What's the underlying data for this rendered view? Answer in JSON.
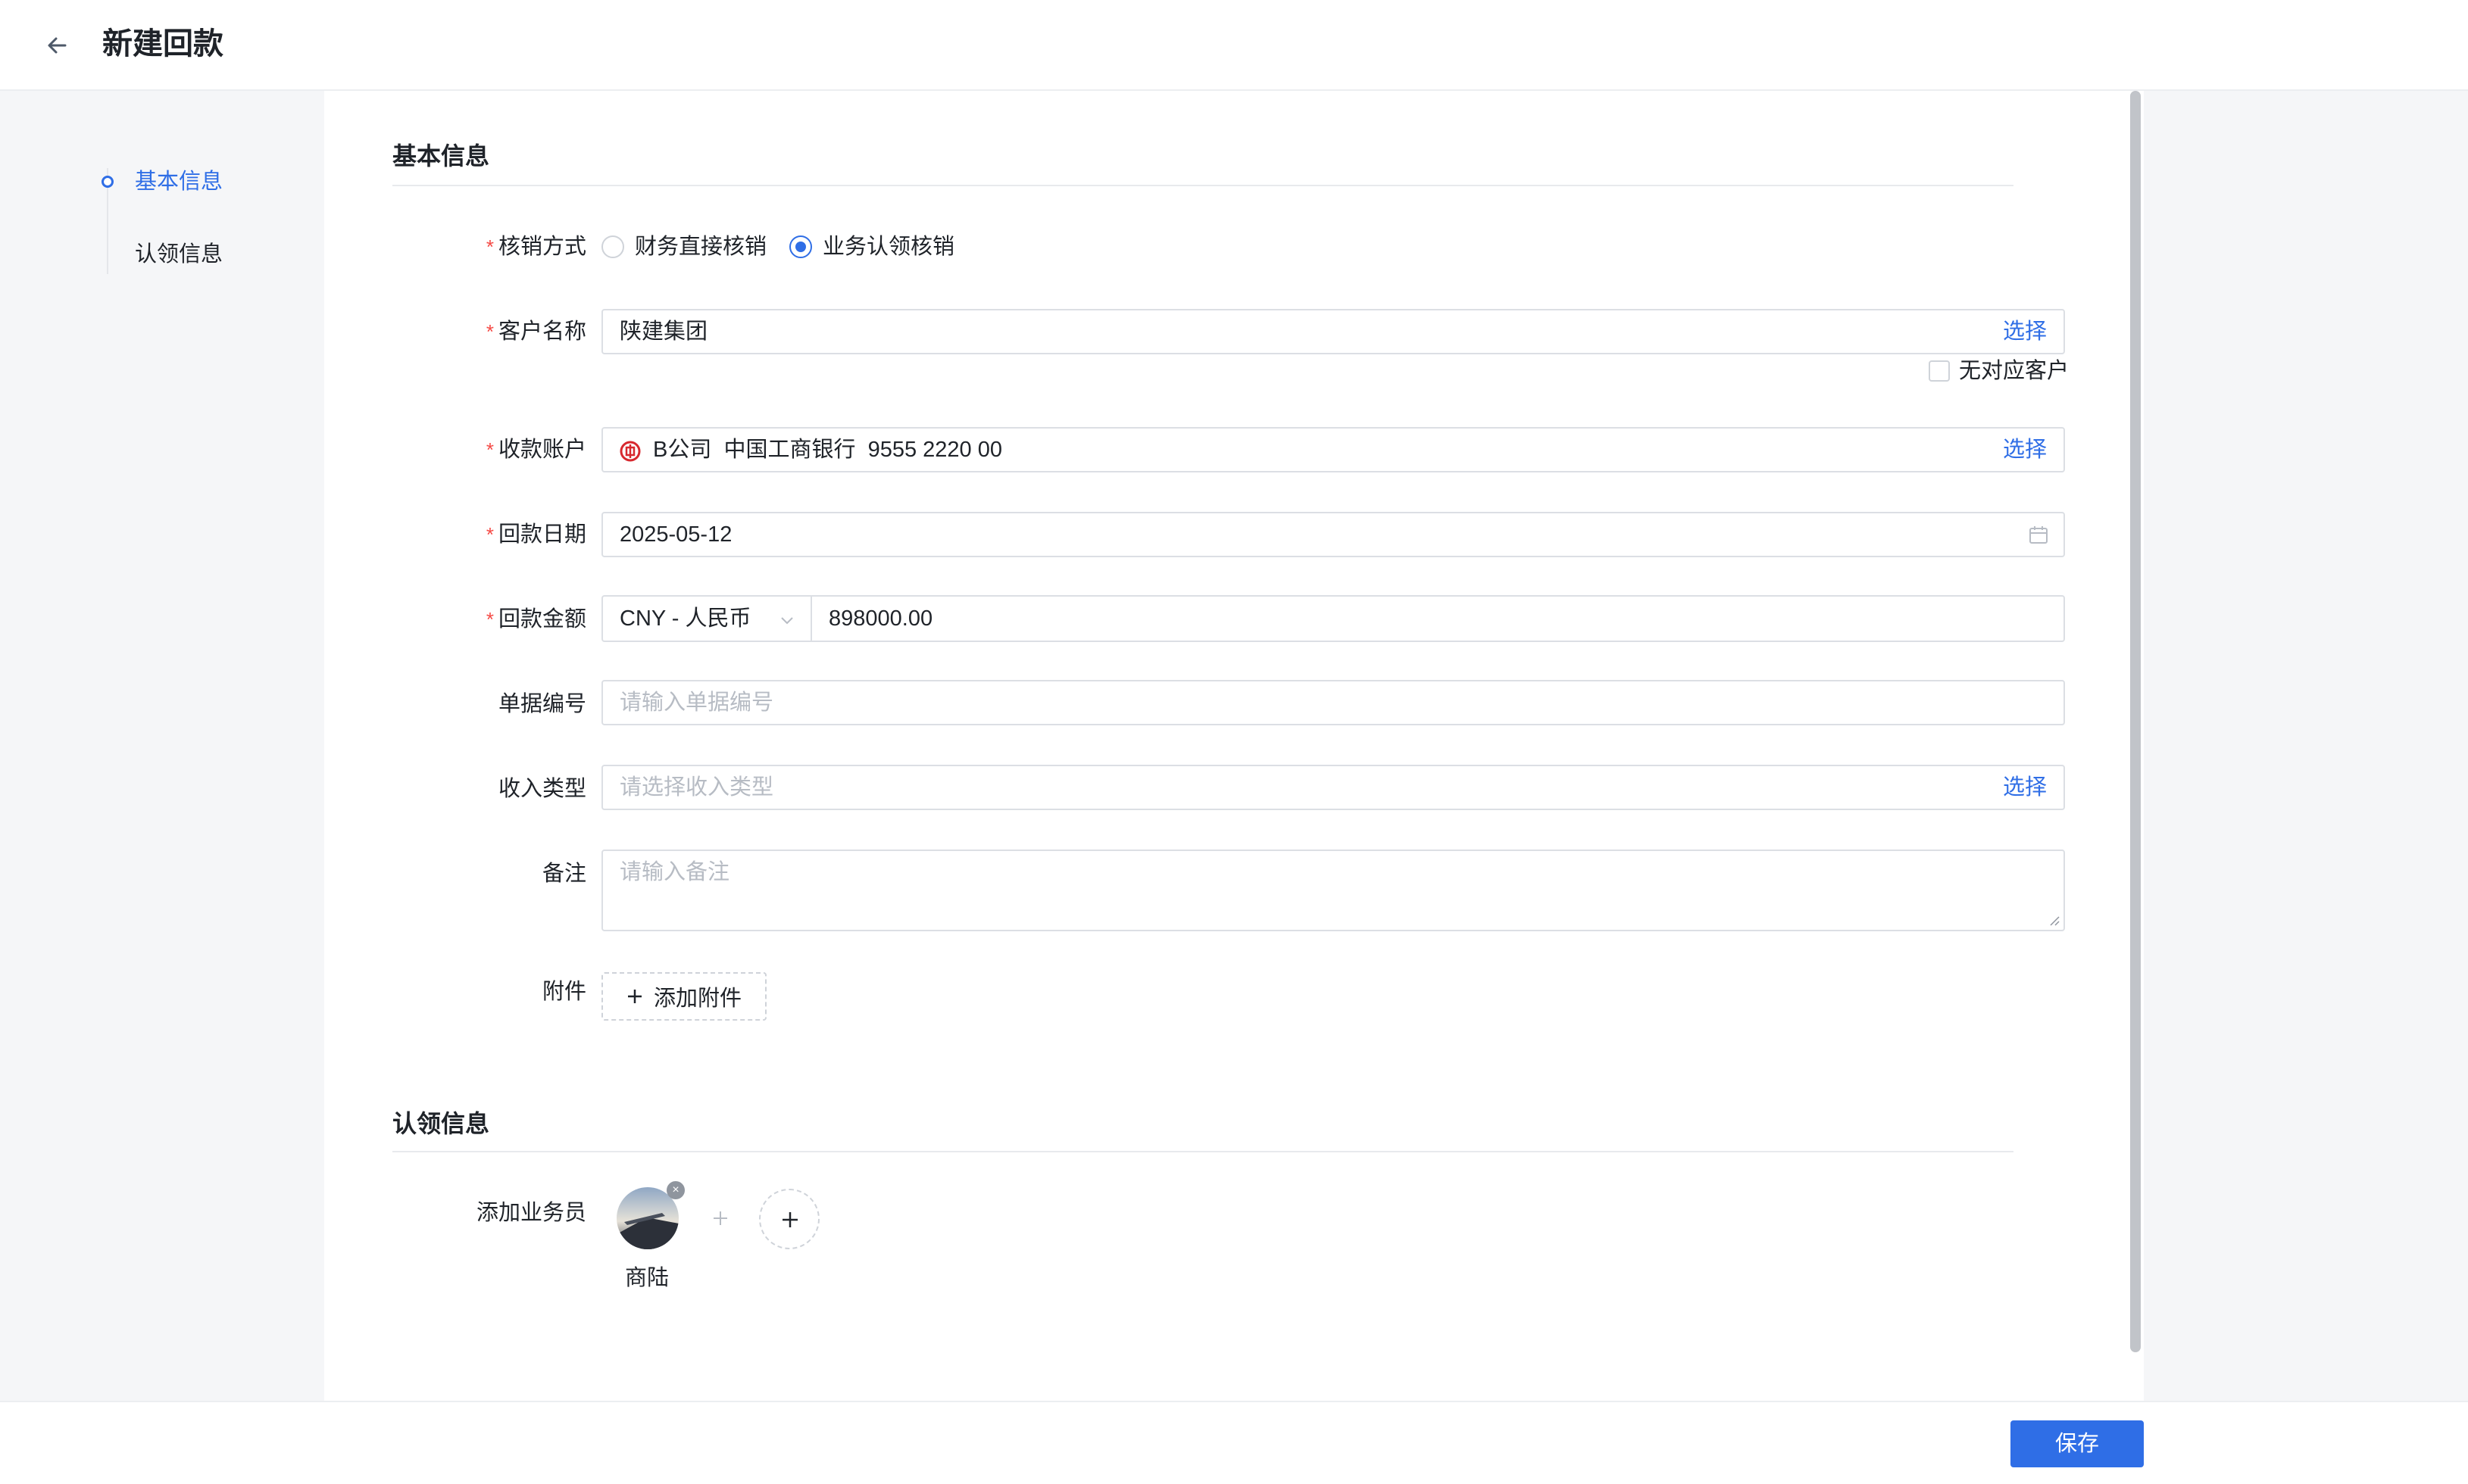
{
  "header": {
    "title": "新建回款"
  },
  "sidenav": {
    "items": [
      {
        "label": "基本信息"
      },
      {
        "label": "认领信息"
      }
    ]
  },
  "basic": {
    "section_title": "基本信息",
    "writeoff": {
      "label": "核销方式",
      "options": [
        {
          "label": "财务直接核销",
          "checked": false
        },
        {
          "label": "业务认领核销",
          "checked": true
        }
      ]
    },
    "customer": {
      "label": "客户名称",
      "value": "陕建集团",
      "action": "选择",
      "no_customer_label": "无对应客户"
    },
    "account": {
      "label": "收款账户",
      "value": "B公司  中国工商银行  9555 2220 00",
      "action": "选择"
    },
    "date": {
      "label": "回款日期",
      "value": "2025-05-12"
    },
    "amount": {
      "label": "回款金额",
      "currency": "CNY - 人民币",
      "value": "898000.00"
    },
    "doc_no": {
      "label": "单据编号",
      "placeholder": "请输入单据编号"
    },
    "income_type": {
      "label": "收入类型",
      "placeholder": "请选择收入类型",
      "action": "选择"
    },
    "remark": {
      "label": "备注",
      "placeholder": "请输入备注"
    },
    "attachment": {
      "label": "附件",
      "button": "添加附件"
    }
  },
  "claim": {
    "section_title": "认领信息",
    "salesperson_label": "添加业务员",
    "salespersons": [
      {
        "name": "商陆"
      }
    ]
  },
  "footer": {
    "save_label": "保存"
  },
  "colors": {
    "accent": "#2f6ee6",
    "required": "#f54a45",
    "bank": "#d7282e"
  }
}
